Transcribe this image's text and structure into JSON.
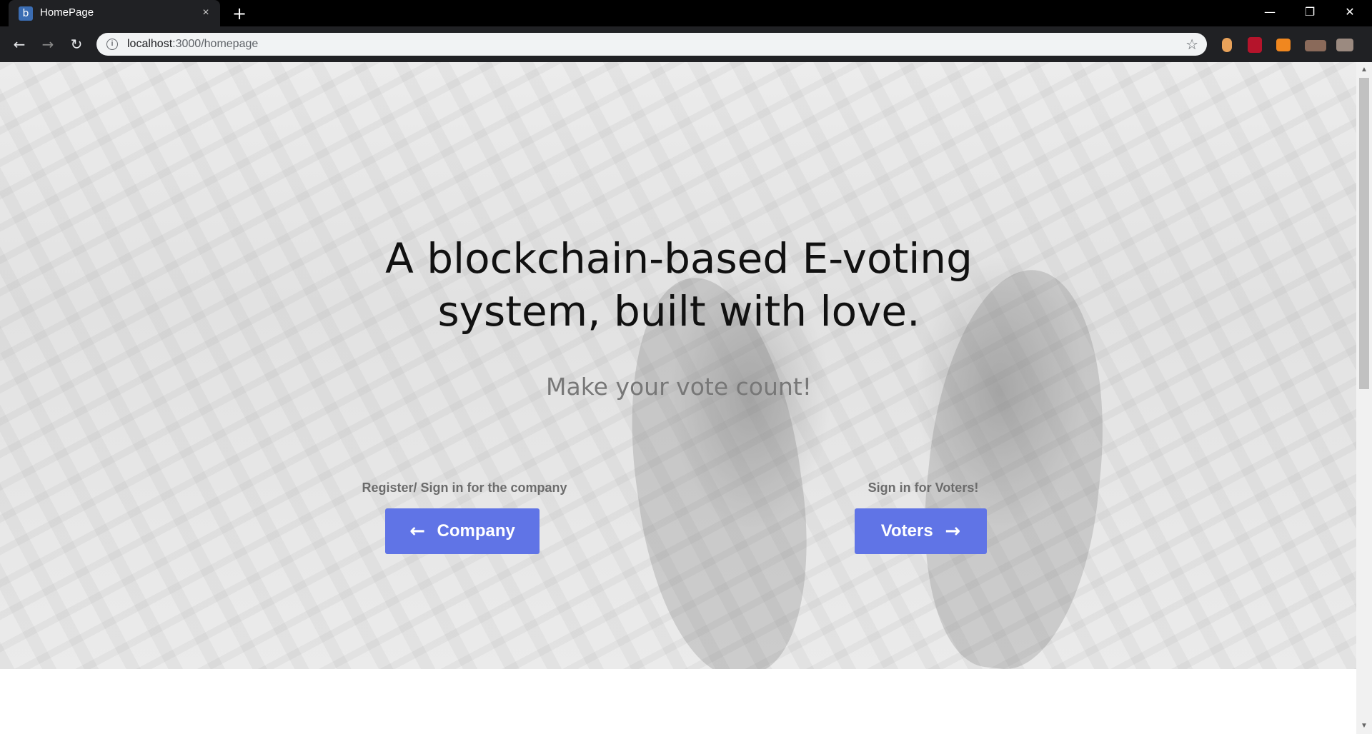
{
  "browser": {
    "tab_title": "HomePage",
    "favicon_letter": "b",
    "tab_close": "×",
    "new_tab": "+",
    "url_host": "localhost",
    "url_path": ":3000/homepage",
    "window_controls": {
      "minimize": "—",
      "restore": "❐",
      "close": "✕"
    },
    "nav": {
      "back": "←",
      "forward": "→",
      "reload": "↻"
    },
    "icons": [
      "info-icon",
      "star-icon",
      "extension-icon"
    ]
  },
  "hero": {
    "headline_line1": "A blockchain-based E-voting",
    "headline_line2": "system, built with love.",
    "tagline": "Make your vote count!",
    "company": {
      "label": "Register/ Sign in for the company",
      "button": "Company",
      "arrow": "←"
    },
    "voters": {
      "label": "Sign in for Voters!",
      "button": "Voters",
      "arrow": "→"
    }
  },
  "colors": {
    "button": "#6074e6",
    "headline": "#111111",
    "tagline": "#777777"
  }
}
